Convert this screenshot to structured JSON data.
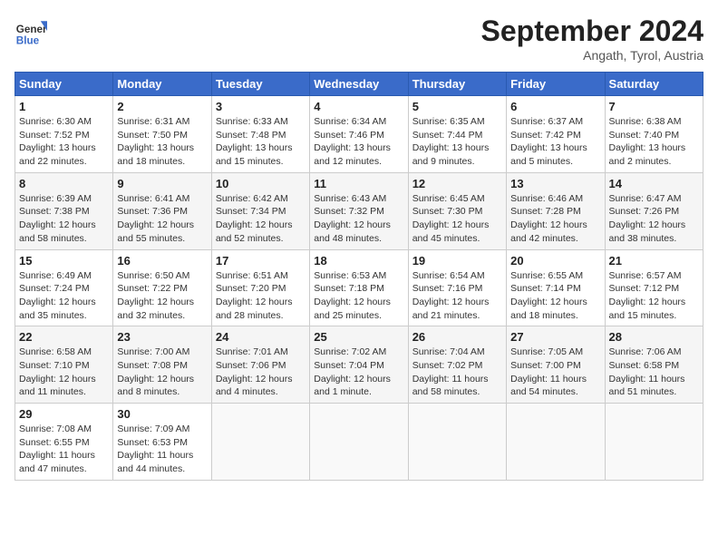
{
  "header": {
    "title": "September 2024",
    "subtitle": "Angath, Tyrol, Austria"
  },
  "logo": {
    "line1": "General",
    "line2": "Blue"
  },
  "days_of_week": [
    "Sunday",
    "Monday",
    "Tuesday",
    "Wednesday",
    "Thursday",
    "Friday",
    "Saturday"
  ],
  "weeks": [
    [
      {
        "day": "1",
        "info": "Sunrise: 6:30 AM\nSunset: 7:52 PM\nDaylight: 13 hours\nand 22 minutes."
      },
      {
        "day": "2",
        "info": "Sunrise: 6:31 AM\nSunset: 7:50 PM\nDaylight: 13 hours\nand 18 minutes."
      },
      {
        "day": "3",
        "info": "Sunrise: 6:33 AM\nSunset: 7:48 PM\nDaylight: 13 hours\nand 15 minutes."
      },
      {
        "day": "4",
        "info": "Sunrise: 6:34 AM\nSunset: 7:46 PM\nDaylight: 13 hours\nand 12 minutes."
      },
      {
        "day": "5",
        "info": "Sunrise: 6:35 AM\nSunset: 7:44 PM\nDaylight: 13 hours\nand 9 minutes."
      },
      {
        "day": "6",
        "info": "Sunrise: 6:37 AM\nSunset: 7:42 PM\nDaylight: 13 hours\nand 5 minutes."
      },
      {
        "day": "7",
        "info": "Sunrise: 6:38 AM\nSunset: 7:40 PM\nDaylight: 13 hours\nand 2 minutes."
      }
    ],
    [
      {
        "day": "8",
        "info": "Sunrise: 6:39 AM\nSunset: 7:38 PM\nDaylight: 12 hours\nand 58 minutes."
      },
      {
        "day": "9",
        "info": "Sunrise: 6:41 AM\nSunset: 7:36 PM\nDaylight: 12 hours\nand 55 minutes."
      },
      {
        "day": "10",
        "info": "Sunrise: 6:42 AM\nSunset: 7:34 PM\nDaylight: 12 hours\nand 52 minutes."
      },
      {
        "day": "11",
        "info": "Sunrise: 6:43 AM\nSunset: 7:32 PM\nDaylight: 12 hours\nand 48 minutes."
      },
      {
        "day": "12",
        "info": "Sunrise: 6:45 AM\nSunset: 7:30 PM\nDaylight: 12 hours\nand 45 minutes."
      },
      {
        "day": "13",
        "info": "Sunrise: 6:46 AM\nSunset: 7:28 PM\nDaylight: 12 hours\nand 42 minutes."
      },
      {
        "day": "14",
        "info": "Sunrise: 6:47 AM\nSunset: 7:26 PM\nDaylight: 12 hours\nand 38 minutes."
      }
    ],
    [
      {
        "day": "15",
        "info": "Sunrise: 6:49 AM\nSunset: 7:24 PM\nDaylight: 12 hours\nand 35 minutes."
      },
      {
        "day": "16",
        "info": "Sunrise: 6:50 AM\nSunset: 7:22 PM\nDaylight: 12 hours\nand 32 minutes."
      },
      {
        "day": "17",
        "info": "Sunrise: 6:51 AM\nSunset: 7:20 PM\nDaylight: 12 hours\nand 28 minutes."
      },
      {
        "day": "18",
        "info": "Sunrise: 6:53 AM\nSunset: 7:18 PM\nDaylight: 12 hours\nand 25 minutes."
      },
      {
        "day": "19",
        "info": "Sunrise: 6:54 AM\nSunset: 7:16 PM\nDaylight: 12 hours\nand 21 minutes."
      },
      {
        "day": "20",
        "info": "Sunrise: 6:55 AM\nSunset: 7:14 PM\nDaylight: 12 hours\nand 18 minutes."
      },
      {
        "day": "21",
        "info": "Sunrise: 6:57 AM\nSunset: 7:12 PM\nDaylight: 12 hours\nand 15 minutes."
      }
    ],
    [
      {
        "day": "22",
        "info": "Sunrise: 6:58 AM\nSunset: 7:10 PM\nDaylight: 12 hours\nand 11 minutes."
      },
      {
        "day": "23",
        "info": "Sunrise: 7:00 AM\nSunset: 7:08 PM\nDaylight: 12 hours\nand 8 minutes."
      },
      {
        "day": "24",
        "info": "Sunrise: 7:01 AM\nSunset: 7:06 PM\nDaylight: 12 hours\nand 4 minutes."
      },
      {
        "day": "25",
        "info": "Sunrise: 7:02 AM\nSunset: 7:04 PM\nDaylight: 12 hours\nand 1 minute."
      },
      {
        "day": "26",
        "info": "Sunrise: 7:04 AM\nSunset: 7:02 PM\nDaylight: 11 hours\nand 58 minutes."
      },
      {
        "day": "27",
        "info": "Sunrise: 7:05 AM\nSunset: 7:00 PM\nDaylight: 11 hours\nand 54 minutes."
      },
      {
        "day": "28",
        "info": "Sunrise: 7:06 AM\nSunset: 6:58 PM\nDaylight: 11 hours\nand 51 minutes."
      }
    ],
    [
      {
        "day": "29",
        "info": "Sunrise: 7:08 AM\nSunset: 6:55 PM\nDaylight: 11 hours\nand 47 minutes."
      },
      {
        "day": "30",
        "info": "Sunrise: 7:09 AM\nSunset: 6:53 PM\nDaylight: 11 hours\nand 44 minutes."
      },
      null,
      null,
      null,
      null,
      null
    ]
  ]
}
